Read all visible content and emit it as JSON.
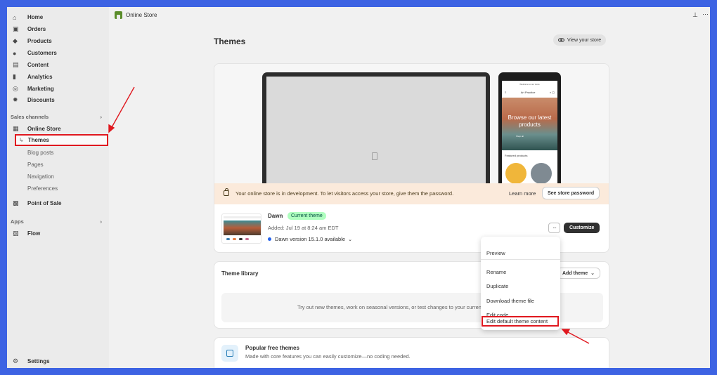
{
  "sidebar": {
    "items": [
      {
        "label": "Home",
        "icon": "home-icon",
        "glyph": "⌂"
      },
      {
        "label": "Orders",
        "icon": "orders-icon",
        "glyph": "▣"
      },
      {
        "label": "Products",
        "icon": "tag-icon",
        "glyph": "◆"
      },
      {
        "label": "Customers",
        "icon": "person-icon",
        "glyph": "●"
      },
      {
        "label": "Content",
        "icon": "content-icon",
        "glyph": "▤"
      },
      {
        "label": "Analytics",
        "icon": "bar-chart-icon",
        "glyph": "▮"
      },
      {
        "label": "Marketing",
        "icon": "target-icon",
        "glyph": "◎"
      },
      {
        "label": "Discounts",
        "icon": "discount-icon",
        "glyph": "✹"
      }
    ],
    "sales_channels_label": "Sales channels",
    "online_store_label": "Online Store",
    "themes_label": "Themes",
    "sub_items": [
      "Blog posts",
      "Pages",
      "Navigation",
      "Preferences"
    ],
    "point_of_sale_label": "Point of Sale",
    "apps_label": "Apps",
    "flow_label": "Flow",
    "settings_label": "Settings"
  },
  "topbar": {
    "title": "Online Store"
  },
  "main": {
    "page_title": "Themes",
    "view_store_label": "View your store",
    "phone_store_name": "Welcome to our store",
    "phone_brand": "Art Practice",
    "phone_hero_text": "Browse our latest products",
    "phone_hero_button": "Shop all",
    "phone_featured": "Featured products",
    "banner_message": "Your online store is in development. To let visitors access your store, give them the password.",
    "learn_more_label": "Learn more",
    "store_password_label": "See store password",
    "theme_name": "Dawn",
    "theme_badge": "Current theme",
    "theme_added": "Added: Jul 19 at 8:24 am EDT",
    "theme_version": "Dawn version 15.1.0 available",
    "more_label": "···",
    "customize_label": "Customize"
  },
  "library": {
    "title": "Theme library",
    "add_theme_label": "Add theme",
    "empty_text": "Try out new themes, work on seasonal versions, or test changes to your current theme."
  },
  "free_themes": {
    "title": "Popular free themes",
    "subtitle": "Made with core features you can easily customize—no coding needed."
  },
  "menu": {
    "items": [
      "Preview",
      "Rename",
      "Duplicate",
      "Download theme file",
      "Edit code",
      "Edit default theme content"
    ]
  },
  "colors": {
    "accent_highlight": "#e0181f",
    "background_frame": "#3d63e3",
    "badge_green": "#affebf"
  }
}
